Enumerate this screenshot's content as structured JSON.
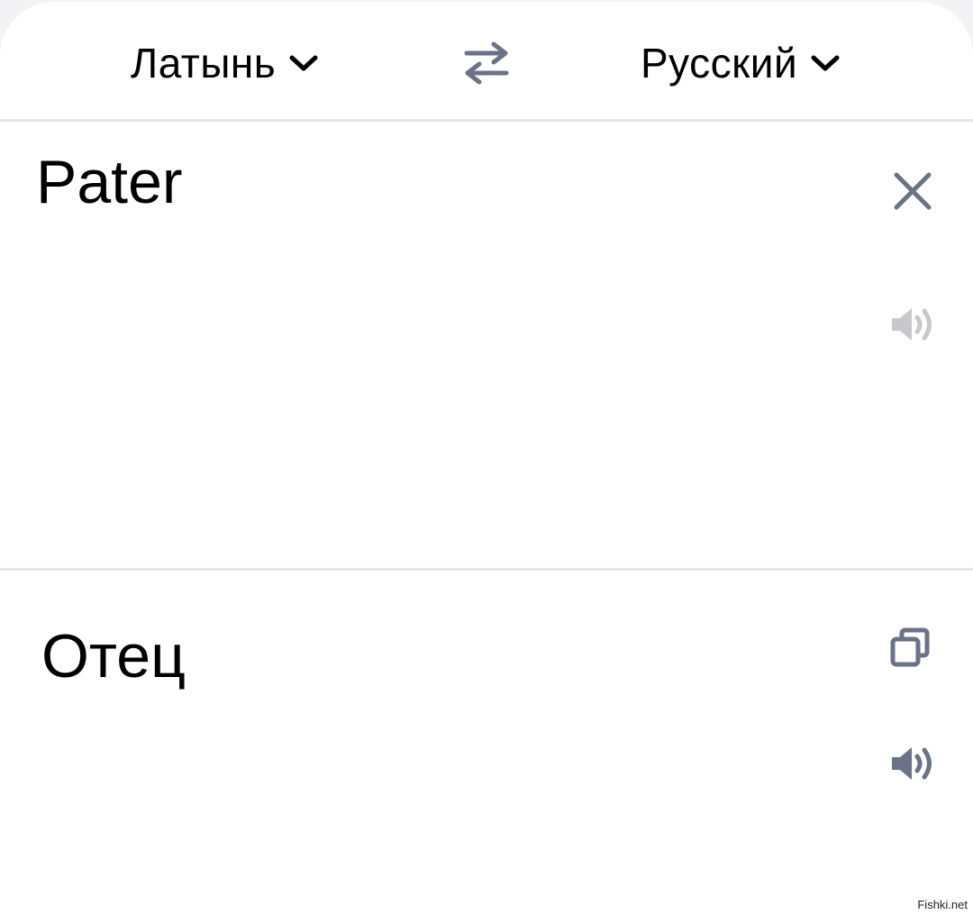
{
  "header": {
    "source_language": "Латынь",
    "target_language": "Русский"
  },
  "source": {
    "text": "Pater"
  },
  "result": {
    "text": "Отец"
  },
  "icons": {
    "source_dropdown": "chevron-down-icon",
    "target_dropdown": "chevron-down-icon",
    "swap": "swap-arrows-icon",
    "clear": "close-icon",
    "source_speaker": "speaker-icon",
    "copy": "copy-icon",
    "result_speaker": "speaker-icon"
  },
  "colors": {
    "icon_active": "#6b7186",
    "icon_disabled": "#c8c8cc",
    "divider": "#e6e6e8"
  },
  "watermark": "Fishki.net"
}
